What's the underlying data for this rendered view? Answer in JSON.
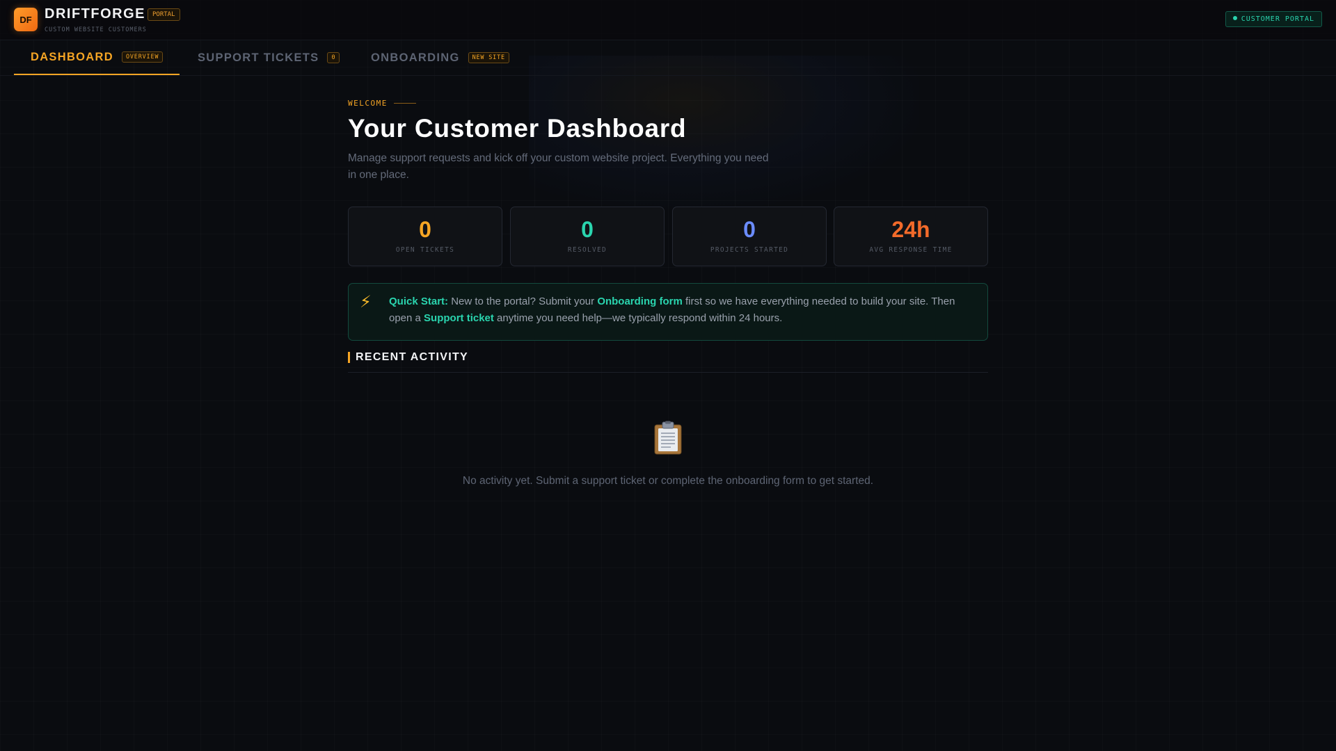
{
  "brand": {
    "logo_initials": "DF",
    "name": "DRIFTFORGE",
    "badge": "PORTAL",
    "subtitle": "CUSTOM WEBSITE CUSTOMERS"
  },
  "header": {
    "portal_chip_label": "CUSTOMER PORTAL",
    "portal_chip_color": "#2ad4ae"
  },
  "tabs": [
    {
      "label": "DASHBOARD",
      "badge": "OVERVIEW",
      "active": true
    },
    {
      "label": "SUPPORT TICKETS",
      "badge": "0",
      "active": false
    },
    {
      "label": "ONBOARDING",
      "badge": "NEW SITE",
      "active": false
    }
  ],
  "main": {
    "eyebrow": "WELCOME",
    "title": "Your Customer Dashboard",
    "description": "Manage support requests and kick off your custom website project. Everything you need in one place."
  },
  "stats": [
    {
      "value": "0",
      "label": "OPEN TICKETS",
      "color": "#f5a524"
    },
    {
      "value": "0",
      "label": "RESOLVED",
      "color": "#2ad4ae"
    },
    {
      "value": "0",
      "label": "PROJECTS STARTED",
      "color": "#6b8cff"
    },
    {
      "value": "24h",
      "label": "AVG RESPONSE TIME",
      "color": "#f26a2a"
    }
  ],
  "quickstart": {
    "icon": "lightning-icon",
    "lead": "Quick Start:",
    "text1": " New to the portal? Submit your ",
    "link1": "Onboarding form",
    "text2": " first so we have everything needed to build your site. Then open a ",
    "link2": "Support ticket",
    "text3": " anytime you need help—we typically respond within 24 hours."
  },
  "activity": {
    "title": "RECENT ACTIVITY",
    "empty_icon": "clipboard-icon",
    "empty_text": "No activity yet. Submit a support ticket or complete the onboarding form to get started."
  },
  "colors": {
    "accent": "#f5a524",
    "teal": "#2ad4ae",
    "background": "#0a0c10"
  }
}
